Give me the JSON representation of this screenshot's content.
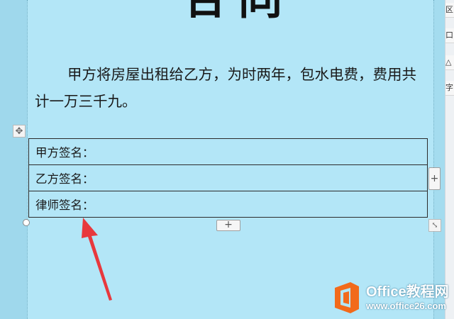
{
  "document": {
    "title": "合同",
    "paragraph": "甲方将房屋出租给乙方，为时两年，包水电费，费用共计一万三千九。"
  },
  "table": {
    "rows": [
      {
        "label": "甲方签名："
      },
      {
        "label": "乙方签名："
      },
      {
        "label": "律师签名："
      }
    ],
    "add_row_label": "+",
    "add_col_label": "+"
  },
  "right_toolbar": {
    "items": [
      "区",
      "口",
      "△",
      "字"
    ]
  },
  "watermark": {
    "name": "Office教程网",
    "url": "www.office26.com"
  },
  "colors": {
    "arrow": "#e8383d",
    "logo_orange": "#f26a1b"
  }
}
